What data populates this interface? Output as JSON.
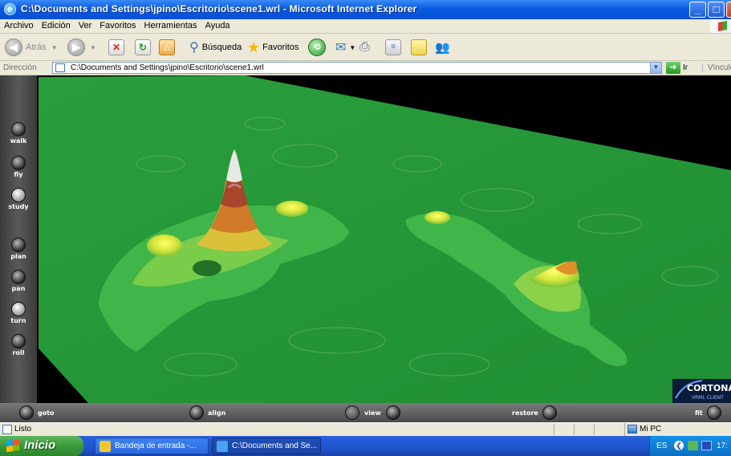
{
  "window": {
    "title": "C:\\Documents and Settings\\jpino\\Escritorio\\scene1.wrl - Microsoft Internet Explorer",
    "buttons": {
      "minimize": "_",
      "maximize": "□",
      "close": "X"
    }
  },
  "menu": [
    "Archivo",
    "Edición",
    "Ver",
    "Favoritos",
    "Herramientas",
    "Ayuda"
  ],
  "toolbar": {
    "back_label": "Atrás",
    "search_label": "Búsqueda",
    "favorites_label": "Favoritos"
  },
  "address": {
    "label": "Dirección",
    "value": "C:\\Documents and Settings\\jpino\\Escritorio\\scene1.wrl",
    "go_label": "Ir",
    "links_label": "Vínculos"
  },
  "cortona": {
    "side_buttons": [
      "walk",
      "fly",
      "study",
      "plan",
      "pan",
      "turn",
      "roll"
    ],
    "bottom_buttons": [
      "goto",
      "align",
      "view",
      "restore",
      "fit"
    ],
    "logo_main": "CORTONA",
    "logo_sub": "VRML CLIENT"
  },
  "status": {
    "text": "Listo",
    "zone": "Mi PC"
  },
  "taskbar": {
    "start_label": "Inicio",
    "tasks": [
      "Bandeja de entrada -...",
      "C:\\Documents and Se..."
    ],
    "lang": "ES",
    "clock": "17:"
  },
  "colors": {
    "title_blue": "#0a5ae0",
    "terrain_green": "#249a3a",
    "chrome": "#ece9d8"
  }
}
